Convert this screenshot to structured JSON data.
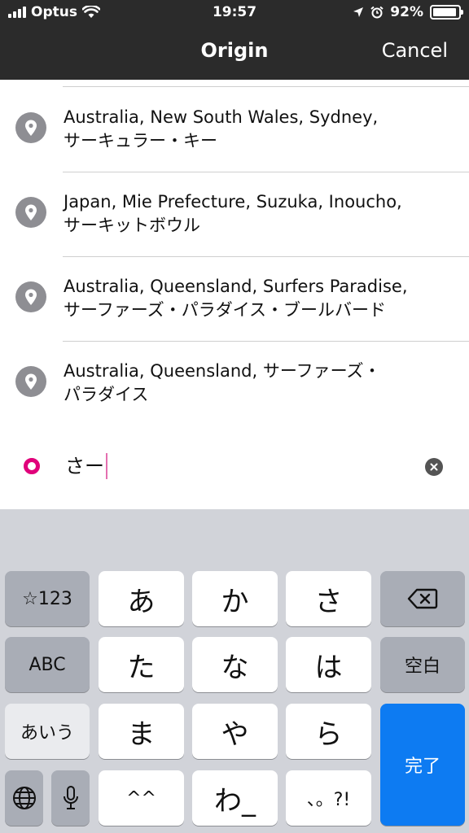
{
  "status_bar": {
    "carrier": "Optus",
    "time": "19:57",
    "battery": "92%",
    "battery_level": 0.92
  },
  "nav": {
    "title": "Origin",
    "cancel_label": "Cancel"
  },
  "results": [
    {
      "line1": "Australia, New South Wales, Sydney,",
      "line2": "サーキュラー・キー"
    },
    {
      "line1": "Japan, Mie Prefecture, Suzuka, Inoucho,",
      "line2": "サーキットボウル"
    },
    {
      "line1": "Australia, Queensland, Surfers Paradise,",
      "line2": "サーファーズ・パラダイス・ブールバード"
    },
    {
      "line1": "Australia, Queensland, サーファーズ・",
      "line2": "パラダイス"
    }
  ],
  "search": {
    "value": "さー"
  },
  "keyboard": {
    "symbols_key": "☆123",
    "row1": [
      "あ",
      "か",
      "さ"
    ],
    "abc_key": "ABC",
    "row2": [
      "た",
      "な",
      "は"
    ],
    "space_key": "空白",
    "hiragana_key": "あいう",
    "row3": [
      "ま",
      "や",
      "ら"
    ],
    "done_key": "完了",
    "row4": [
      "^^",
      "わ_",
      "、。?!"
    ]
  },
  "colors": {
    "nav_background": "#2b2b2b",
    "origin_accent": "#e0007a",
    "done_key": "#0d7bf2",
    "pin_gray": "#8e8e93"
  }
}
